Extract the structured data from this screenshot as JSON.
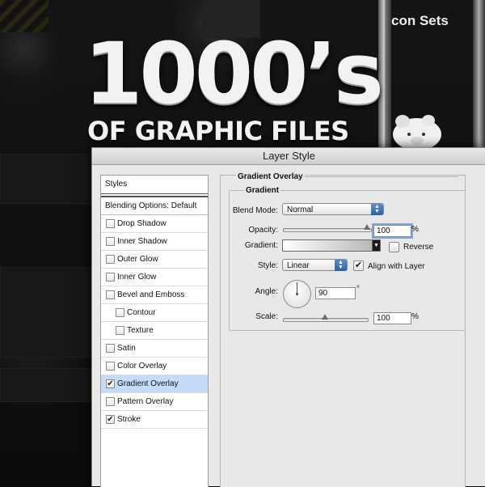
{
  "background": {
    "headline_big": "1000’s",
    "headline_sub": "OF GRAPHIC FILES",
    "corner_text": "con Sets"
  },
  "dialog": {
    "title": "Layer Style",
    "styles_panel": {
      "header": "Styles",
      "blending_options": "Blending Options: Default",
      "items": [
        {
          "label": "Drop Shadow",
          "checked": false,
          "sub": false,
          "selected": false
        },
        {
          "label": "Inner Shadow",
          "checked": false,
          "sub": false,
          "selected": false
        },
        {
          "label": "Outer Glow",
          "checked": false,
          "sub": false,
          "selected": false
        },
        {
          "label": "Inner Glow",
          "checked": false,
          "sub": false,
          "selected": false
        },
        {
          "label": "Bevel and Emboss",
          "checked": false,
          "sub": false,
          "selected": false
        },
        {
          "label": "Contour",
          "checked": false,
          "sub": true,
          "selected": false
        },
        {
          "label": "Texture",
          "checked": false,
          "sub": true,
          "selected": false
        },
        {
          "label": "Satin",
          "checked": false,
          "sub": false,
          "selected": false
        },
        {
          "label": "Color Overlay",
          "checked": false,
          "sub": false,
          "selected": false
        },
        {
          "label": "Gradient Overlay",
          "checked": true,
          "sub": false,
          "selected": true
        },
        {
          "label": "Pattern Overlay",
          "checked": false,
          "sub": false,
          "selected": false
        },
        {
          "label": "Stroke",
          "checked": true,
          "sub": false,
          "selected": false
        }
      ]
    },
    "gradient_overlay": {
      "section_title": "Gradient Overlay",
      "group_title": "Gradient",
      "blend_mode_label": "Blend Mode:",
      "blend_mode_value": "Normal",
      "opacity_label": "Opacity:",
      "opacity_value": "100",
      "opacity_unit": "%",
      "opacity_level": 1.0,
      "gradient_label": "Gradient:",
      "gradient_colors": [
        "#ffffff",
        "#b9b9b9"
      ],
      "reverse_label": "Reverse",
      "reverse_checked": false,
      "style_label": "Style:",
      "style_value": "Linear",
      "align_label": "Align with Layer",
      "align_checked": true,
      "angle_label": "Angle:",
      "angle_value": "90",
      "angle_unit": "°",
      "scale_label": "Scale:",
      "scale_value": "100",
      "scale_unit": "%",
      "scale_level": 0.5
    }
  },
  "colors": {
    "selected_row": "#c5dcf7",
    "select_arrow": "#2d5fa6",
    "dialog_bg": "#e8e8e8"
  }
}
